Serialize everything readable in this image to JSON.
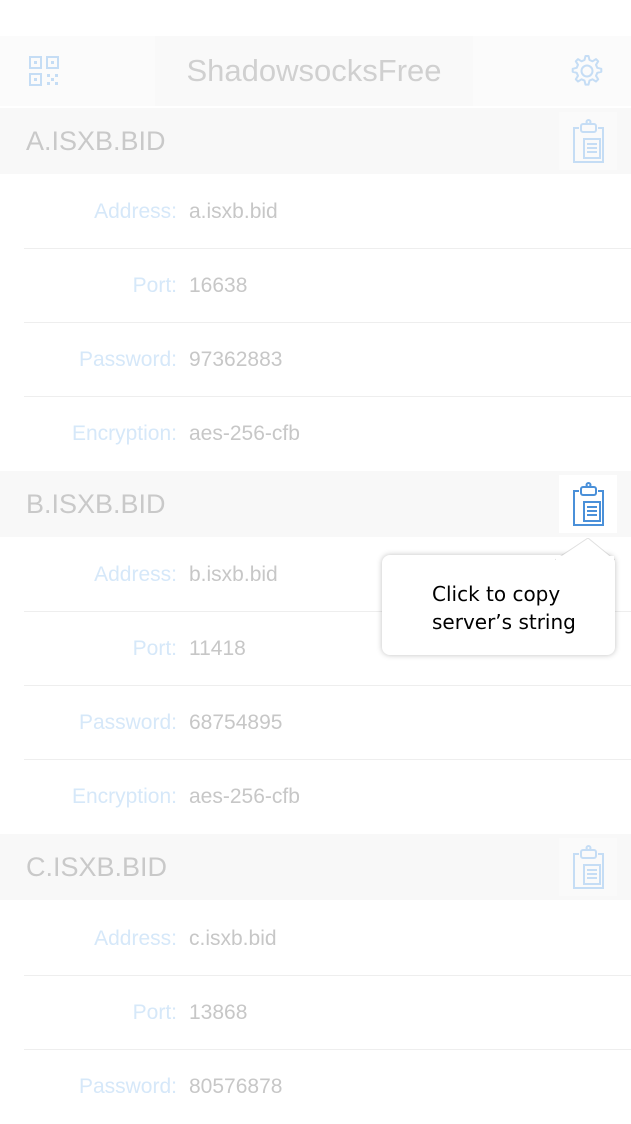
{
  "navbar": {
    "title": "ShadowsocksFree",
    "left_icon": "qr-code-icon",
    "right_icon": "gear-icon"
  },
  "servers": [
    {
      "title": "A.ISXB.BID",
      "fields": [
        {
          "label": "Address:",
          "value": "a.isxb.bid"
        },
        {
          "label": "Port:",
          "value": "16638"
        },
        {
          "label": "Password:",
          "value": "97362883"
        },
        {
          "label": "Encryption:",
          "value": "aes-256-cfb"
        }
      ]
    },
    {
      "title": "B.ISXB.BID",
      "fields": [
        {
          "label": "Address:",
          "value": "b.isxb.bid"
        },
        {
          "label": "Port:",
          "value": "11418"
        },
        {
          "label": "Password:",
          "value": "68754895"
        },
        {
          "label": "Encryption:",
          "value": "aes-256-cfb"
        }
      ]
    },
    {
      "title": "C.ISXB.BID",
      "fields": [
        {
          "label": "Address:",
          "value": "c.isxb.bid"
        },
        {
          "label": "Port:",
          "value": "13868"
        },
        {
          "label": "Password:",
          "value": "80576878"
        }
      ]
    }
  ],
  "tooltip": {
    "line1": "Click to copy",
    "line2": "server’s string"
  },
  "colors": {
    "accent": "#4a90d9",
    "accent_faded": "#c5ddf5"
  }
}
